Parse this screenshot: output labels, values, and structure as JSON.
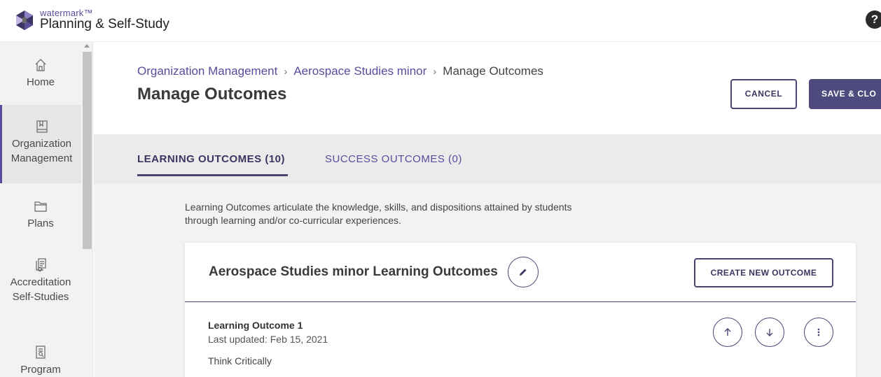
{
  "header": {
    "brand_small": "watermark™",
    "app_title": "Planning & Self-Study",
    "help_icon": "?"
  },
  "sidebar": {
    "items": [
      {
        "label_lines": [
          "Home"
        ],
        "icon": "home-icon"
      },
      {
        "label_lines": [
          "Organization",
          "Management"
        ],
        "icon": "book-icon",
        "active": true
      },
      {
        "label_lines": [
          "Plans"
        ],
        "icon": "folder-icon"
      },
      {
        "label_lines": [
          "Accreditation",
          "Self-Studies"
        ],
        "icon": "document-stack-icon"
      },
      {
        "label_lines": [
          "Program"
        ],
        "icon": "document-search-icon"
      }
    ]
  },
  "breadcrumb": {
    "items": [
      "Organization Management",
      "Aerospace Studies minor"
    ],
    "separator": "›",
    "current": "Manage Outcomes"
  },
  "page": {
    "title": "Manage Outcomes",
    "cancel_label": "CANCEL",
    "save_label": "SAVE & CLO"
  },
  "tabs": [
    {
      "label": "LEARNING OUTCOMES (10)",
      "active": true
    },
    {
      "label": "SUCCESS OUTCOMES (0)",
      "active": false
    }
  ],
  "description": "Learning Outcomes articulate the knowledge, skills, and dispositions attained by students through learning and/or co-curricular experiences.",
  "card": {
    "title": "Aerospace Studies minor Learning Outcomes",
    "create_label": "CREATE NEW OUTCOME",
    "outcome": {
      "name": "Learning Outcome 1",
      "updated": "Last updated: Feb 15, 2021",
      "text": "Think Critically"
    }
  },
  "colors": {
    "accent": "#4e4374",
    "link": "#5a4b9c",
    "sidebar_bg": "#f2f2f2"
  }
}
